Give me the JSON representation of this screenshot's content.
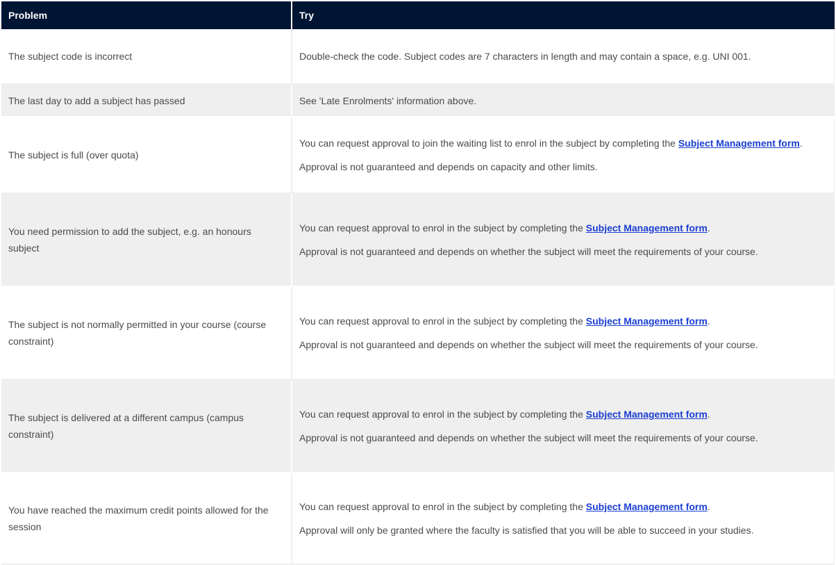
{
  "table": {
    "headers": {
      "problem": "Problem",
      "try": "Try"
    },
    "rows": [
      {
        "problem": "The subject code is incorrect",
        "try_before": "Double-check the code. Subject codes are 7 characters in length and may contain a space, e.g. UNI 001."
      },
      {
        "problem": "The last day to add a subject has passed",
        "try_before": "See 'Late Enrolments' information above."
      },
      {
        "problem": "The subject is full (over quota)",
        "try_before": "You can request approval to join the waiting list to enrol in the subject by completing the ",
        "link": "Subject Management form",
        "try_after": ".",
        "note": "Approval is not guaranteed and depends on capacity and other limits."
      },
      {
        "problem": "You need permission to add the subject, e.g. an honours subject",
        "try_before": "You can request approval to enrol in the subject by completing the ",
        "link": "Subject Management form",
        "try_after": ".",
        "note": "Approval is not guaranteed and depends on whether the subject will meet the requirements of your course."
      },
      {
        "problem": "The subject is not normally permitted in your course (course constraint)",
        "try_before": "You can request approval to enrol in the subject by completing the ",
        "link": "Subject Management form",
        "try_after": ".",
        "note": "Approval is not guaranteed and depends on whether the subject will meet the requirements of your course."
      },
      {
        "problem": "The subject is delivered at a different campus (campus constraint)",
        "try_before": "You can request approval to enrol in the subject by completing the ",
        "link": "Subject Management form",
        "try_after": ".",
        "note": "Approval is not guaranteed and depends on whether the subject will meet the requirements of your course."
      },
      {
        "problem": "You have reached the maximum credit points allowed for the session",
        "try_before": "You can request approval to enrol in the subject by completing the ",
        "link": "Subject Management form",
        "try_after": ".",
        "note": "Approval will only be granted where the faculty is satisfied that you will be able to succeed in your studies."
      }
    ]
  },
  "colors": {
    "header_bg": "#001434",
    "row_alt_bg": "#efefef",
    "link": "#1a3ed1",
    "text": "#4a4a4a"
  }
}
